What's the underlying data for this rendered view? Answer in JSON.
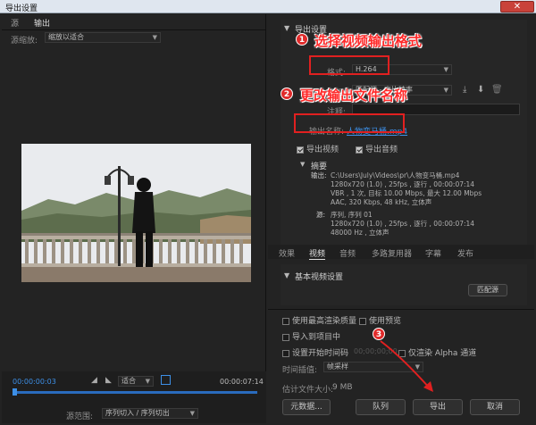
{
  "window": {
    "title": "导出设置",
    "close": "✕"
  },
  "left": {
    "tabs": [
      {
        "label": "源"
      },
      {
        "label": "输出"
      }
    ],
    "scale_label": "源缩放:",
    "scale_value": "缩放以适合",
    "timecode_left": "00:00:00:03",
    "fit_value": "适合",
    "timecode_right": "00:00:07:14",
    "range_label": "源范围:",
    "range_value": "序列切入 / 序列切出"
  },
  "right": {
    "section_title": "导出设置",
    "format_label": "格式:",
    "format_value": "H.264",
    "preset_label": "预设:",
    "preset_value": "匹配源 - 高比特率",
    "comments_label": "注释:",
    "output_name_label": "输出名称:",
    "output_name_value": "人物变马桶.mp4",
    "export_video": "导出视频",
    "export_audio": "导出音频",
    "summary_title": "摘要",
    "summary_output_key": "输出:",
    "summary_output_lines": [
      "C:\\Users\\July\\Videos\\pr\\人物变马桶.mp4",
      "1280x720 (1.0) , 25fps , 逐行 , 00:00:07:14",
      "VBR , 1 次, 目标 10.00 Mbps, 最大 12.00 Mbps",
      "AAC, 320 Kbps, 48 kHz, 立体声"
    ],
    "summary_source_key": "源:",
    "summary_source_lines": [
      "序列, 序列 01",
      "1280x720 (1.0) , 25fps , 逐行 , 00:00:07:14",
      "48000 Hz , 立体声"
    ],
    "tabs": [
      {
        "label": "效果"
      },
      {
        "label": "视频"
      },
      {
        "label": "音频"
      },
      {
        "label": "多路复用器"
      },
      {
        "label": "字幕"
      },
      {
        "label": "发布"
      }
    ],
    "basic_video_title": "基本视频设置",
    "match_source_btn": "匹配源",
    "opt_max_render": "使用最高渲染质量",
    "opt_use_preview": "使用预览",
    "opt_import_project": "导入到项目中",
    "opt_set_start_tc": "设置开始时间码",
    "opt_start_tc_value": "00;00;00;00",
    "opt_render_alpha": "仅渲染 Alpha 通道",
    "time_interp_label": "时间插值:",
    "time_interp_value": "帧采样",
    "file_size_label": "估计文件大小:",
    "file_size_value": "9 MB",
    "btn_metadata": "元数据...",
    "btn_queue": "队列",
    "btn_export": "导出",
    "btn_cancel": "取消"
  },
  "annotations": {
    "step1_num": "1",
    "step1_text": "选择视频输出格式",
    "step2_num": "2",
    "step2_text": "更改输出文件名称",
    "step3_num": "3"
  },
  "colors": {
    "annotation_red": "#e12020",
    "timecode_blue": "#3d8fe6"
  }
}
